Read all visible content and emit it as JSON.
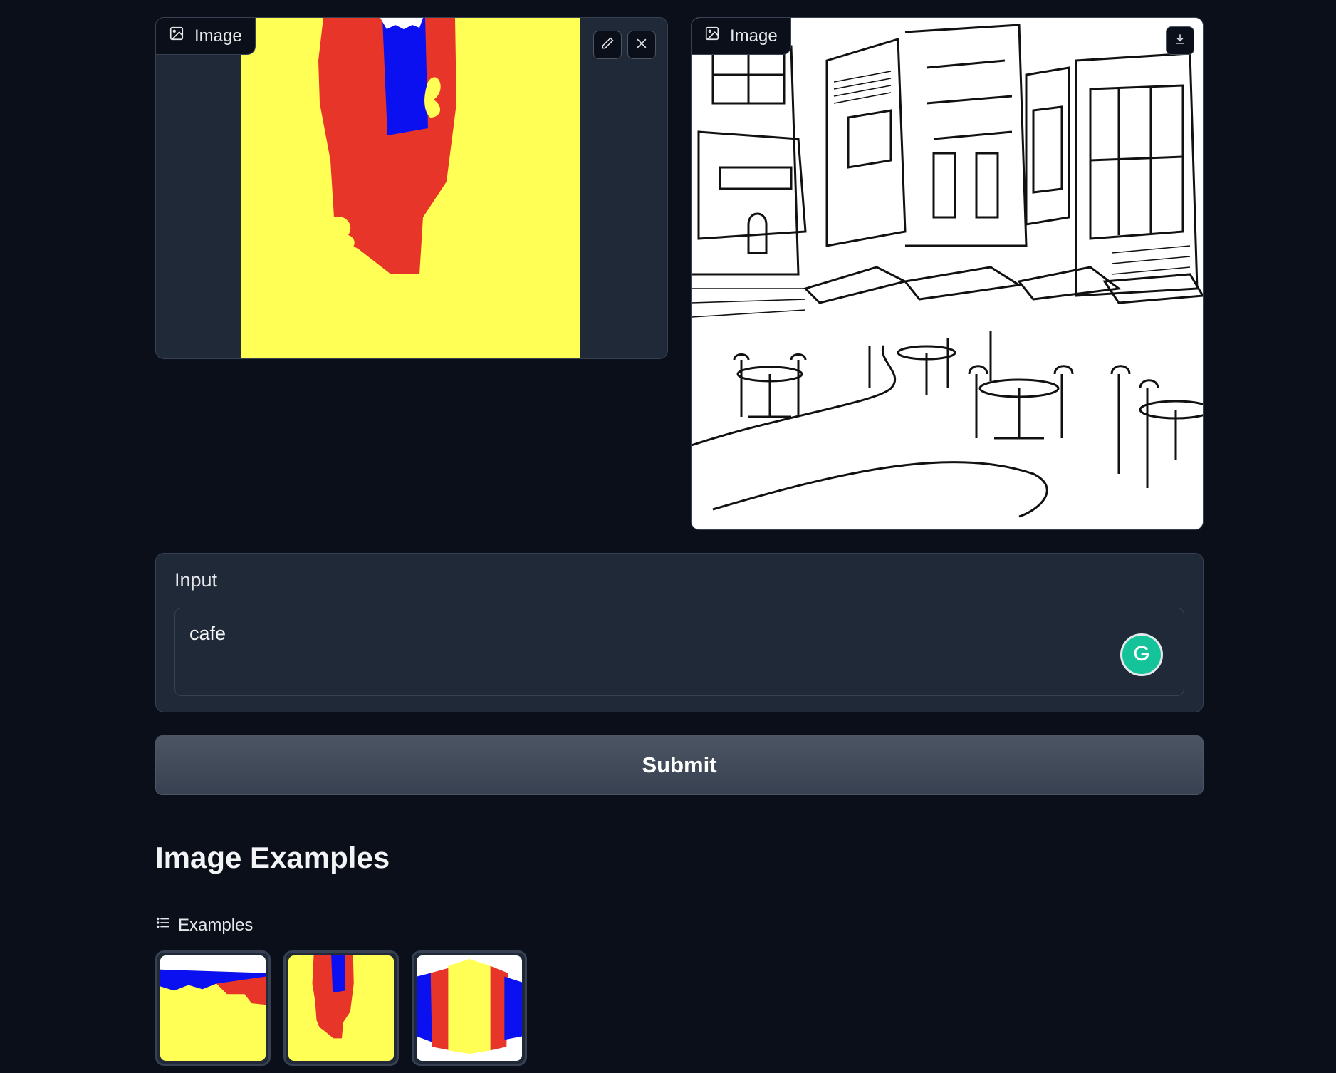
{
  "input_image": {
    "label": "Image",
    "edit_icon": "pencil-icon",
    "clear_icon": "close-icon"
  },
  "output_image": {
    "label": "Image",
    "download_icon": "download-icon"
  },
  "prompt": {
    "label": "Input",
    "value": "cafe"
  },
  "submit_label": "Submit",
  "examples_section": {
    "title": "Image Examples",
    "label": "Examples",
    "items": [
      "segmentation-map-1",
      "segmentation-map-2",
      "segmentation-map-3"
    ]
  },
  "colors": {
    "background": "#0b0f19",
    "panel": "#1f2937",
    "border": "#374151",
    "seg_yellow": "#ffff55",
    "seg_red": "#e8352a",
    "seg_blue": "#0a10f0"
  }
}
